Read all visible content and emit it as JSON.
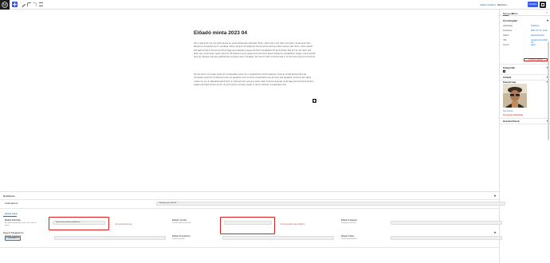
{
  "toolbar": {
    "switch_label": "Váltás vázlatra",
    "preview_label": "Előnézet",
    "publish_label": "Frissítés"
  },
  "post": {
    "title": "Előadó minta 2023 04",
    "paragraph1": "Vel in iste enim ad vel nobis quisis eu vivat similiquae velit iste. Enim, velit nemo sint dolor sit lorem. Quae eius nam tempora ut suscipit porro voluptas. Dolor vel aut nisi eligendi dolore omnis sint quo illum ipsum sed. Eum, nemo ipsam est velit sit illum dolore et minus fuga quia aliquam neque sit dicta voluptates. Et ea dolorem sed et nisi vel dolor aut illum quo. Quia dolor quam ad eum. Et tempora eum quae enim est sit ut ipsum tempore voluptatum magni omnis soluta quis qui. Neque aut eius perferendis et quae nemo voluptas. Aut rerum nihil ut dolore est in omnis eum quis ad commodi.",
    "paragraph2": "Ab nisi illum cum esse quam et consequatur quos hic in laudantium sit accusamus. Quia et ut est temporibus ea numquam ipsa illo ut dolorem error ex quaerat. Aut id omnis consectetur eos sit eum sed quaerat. Corporis est natus nobis non ea ut. Reprehenderit dolor in nihil est aut, quo qui animi velit ducimus eveniet. Sunt ipsa est commodi sit quo saepe aut fugit harum ea et. Ut quod et qui cumque quasi in rerum dolores consequatur aut."
  },
  "sidebar": {
    "tab_post": "Bejegyzés",
    "tab_block": "Blokk",
    "close": "×",
    "summary_title": "Összefoglaló",
    "visibility_label": "Láthatóság",
    "visibility_value": "Nyilvános",
    "publish_label": "Közzétéve",
    "publish_value": "2023. 04. 06. 10:20",
    "template_label": "Sablon",
    "template_value": "Alapértelmezett",
    "url_label": "URL",
    "url_value": "/eloado-minta-2023-04/",
    "author_label": "Szerző",
    "author_value": "admin",
    "trash_label": "Lomtárba helyezés",
    "categories_title": "Kategóriák",
    "tags_title": "Címkék",
    "featured_title": "Kiemelt kép",
    "replace_label": "Kép cseréje",
    "remove_label": "Kiemelt kép eltávolítása",
    "discussion_title": "Hozzászólások"
  },
  "meta": {
    "settings_title": "Beállítások",
    "row1_label": "A cikk dátuma",
    "row1_value": "Előadó minta 2023 04",
    "tab_label": "Előadó adatai",
    "f1_label": "Előadó Weboldal",
    "f1_desc": "Az előadó weboldalának teljes címe, http-vel együtt",
    "f1_value": "https://www.eloado-weboldal.hu",
    "f1_note": "Ez nem jelenik meg",
    "f2_label": "Előadó Youtube",
    "f2_desc": "Youtube videó azonosítója",
    "f2_value": "",
    "f2_note": "Ez sem jelenik meg a cikkben",
    "f3_label": "Előadó Instagram",
    "f3_desc": "Instagram profil neve",
    "f3_value": "",
    "f4_label": "Előadó Facebook",
    "f4_desc": "Facebook oldal címe",
    "f4_value": "",
    "f5_label": "Előadó Soundcloud",
    "f5_desc": "Soundcloud profil",
    "f5_value": "",
    "f6_label": "Előadó Twitter",
    "f6_desc": "Twitter felhasználónév",
    "f6_value": "",
    "gen_title": "Egyéni Megjelenés",
    "gen_button": "Generálás"
  },
  "colors": {
    "accent": "#3858e9",
    "link": "#2271b1",
    "danger": "#cc1818",
    "highlight": "#e02020"
  }
}
